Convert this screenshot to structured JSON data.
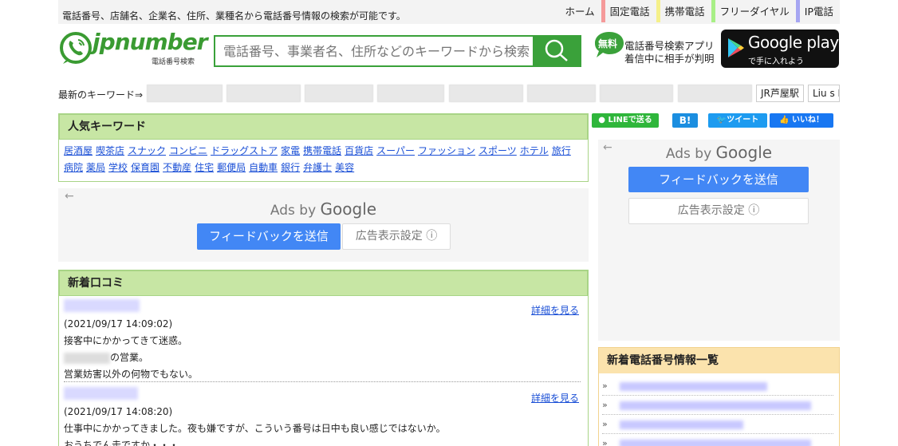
{
  "topbar": {
    "tagline": "電話番号、店舗名、企業名、住所、業種名から電話番号情報の検索が可能です。",
    "nav": [
      {
        "label": "ホーム",
        "color": "#f3f3f3"
      },
      {
        "label": "固定電話",
        "color": "#f59a9a"
      },
      {
        "label": "携帯電話",
        "color": "#f5f08a"
      },
      {
        "label": "フリーダイヤル",
        "color": "#a8ef86"
      },
      {
        "label": "IP電話",
        "color": "#a6a6f2"
      }
    ]
  },
  "header": {
    "logo_text": "jpnumber",
    "logo_sub": "電話番号検索",
    "search_placeholder": "電話番号、事業者名、住所などのキーワードから検索",
    "app_badge": "無料",
    "app_line1": "電話番号検索アプリ",
    "app_line2": "着信中に相手が判明",
    "gplay_main": "Google play",
    "gplay_sub": "で手に入れよう"
  },
  "keywords": {
    "label": "最新のキーワード⇒",
    "visible_chip_1": "JR芦屋駅",
    "visible_chip_2": "Liu s E"
  },
  "popular": {
    "title": "人気キーワード",
    "links": [
      "居酒屋",
      "喫茶店",
      "スナック",
      "コンビニ",
      "ドラッグストア",
      "家電",
      "携帯電話",
      "百貨店",
      "スーパー",
      "ファッション",
      "スポーツ",
      "ホテル",
      "旅行",
      "病院",
      "薬局",
      "学校",
      "保育園",
      "不動産",
      "住宅",
      "郵便局",
      "自動車",
      "銀行",
      "弁護士",
      "美容"
    ]
  },
  "ads": {
    "ads_by": "Ads by",
    "google": "Google",
    "feedback": "フィードバックを送信",
    "settings": "広告表示設定 ⓘ"
  },
  "reviews": {
    "title": "新着口コミ",
    "detail_label": "詳細を見る",
    "items": [
      {
        "date": "(2021/09/17 14:09:02)",
        "line1": "接客中にかかってきて迷惑。",
        "line2_suffix": "の営業。",
        "line3": "営業妨害以外の何物でもない。"
      },
      {
        "date": "(2021/09/17 14:08:20)",
        "line1": "仕事中にかかってきました。夜も嫌ですが、こういう番号は日中も良い感じではないか。",
        "line2": "おうちでん走ですか・・・"
      }
    ]
  },
  "share": {
    "line": "LINEで送る",
    "hatena": "B!",
    "tweet": "ツイート",
    "like": "いいね！"
  },
  "new_numbers": {
    "title": "新着電話番号情報一覧",
    "bullet": "»"
  }
}
